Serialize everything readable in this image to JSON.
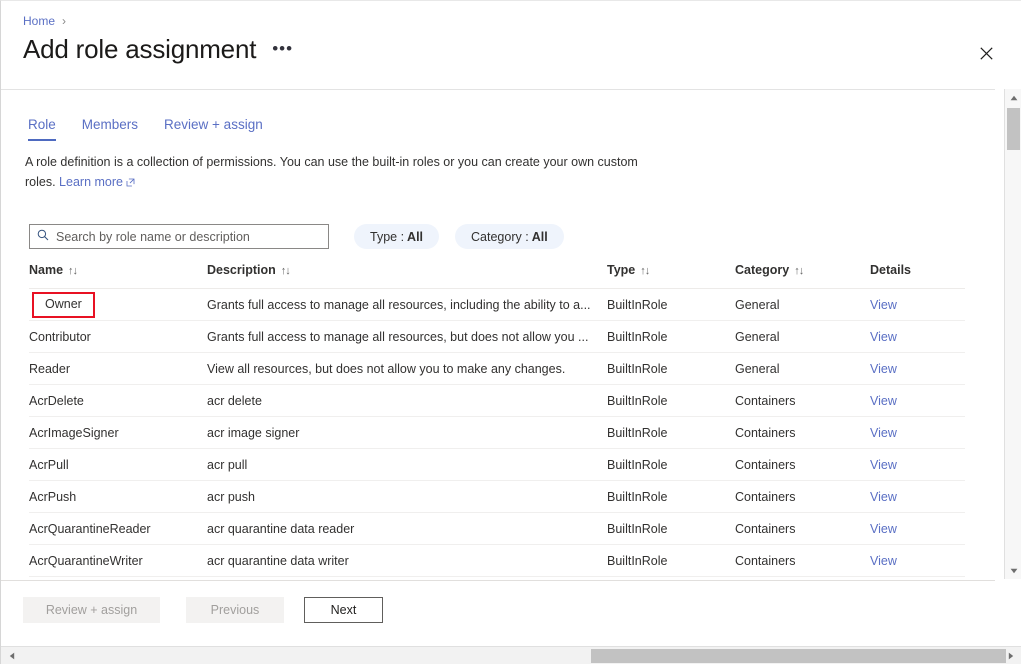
{
  "breadcrumb": {
    "home": "Home",
    "separator": "›"
  },
  "header": {
    "title": "Add role assignment",
    "more_label": "•••",
    "close_label": "✕"
  },
  "tabs": [
    {
      "label": "Role",
      "active": true
    },
    {
      "label": "Members",
      "active": false
    },
    {
      "label": "Review + assign",
      "active": false
    }
  ],
  "description": {
    "text": "A role definition is a collection of permissions. You can use the built-in roles or you can create your own custom roles. ",
    "link": "Learn more"
  },
  "search": {
    "placeholder": "Search by role name or description",
    "value": "",
    "icon": "search-icon"
  },
  "filters": [
    {
      "label": "Type :",
      "value": "All"
    },
    {
      "label": "Category :",
      "value": "All"
    }
  ],
  "table": {
    "sort_glyph": "↑↓",
    "columns": [
      {
        "key": "name",
        "label": "Name",
        "sortable": true
      },
      {
        "key": "description",
        "label": "Description",
        "sortable": true
      },
      {
        "key": "type",
        "label": "Type",
        "sortable": true
      },
      {
        "key": "category",
        "label": "Category",
        "sortable": true
      },
      {
        "key": "details",
        "label": "Details",
        "sortable": false
      }
    ],
    "details_link_label": "View",
    "rows": [
      {
        "name": "Owner",
        "description": "Grants full access to manage all resources, including the ability to a...",
        "type": "BuiltInRole",
        "category": "General",
        "details": "View",
        "highlighted": true
      },
      {
        "name": "Contributor",
        "description": "Grants full access to manage all resources, but does not allow you ...",
        "type": "BuiltInRole",
        "category": "General",
        "details": "View",
        "highlighted": false
      },
      {
        "name": "Reader",
        "description": "View all resources, but does not allow you to make any changes.",
        "type": "BuiltInRole",
        "category": "General",
        "details": "View",
        "highlighted": false
      },
      {
        "name": "AcrDelete",
        "description": "acr delete",
        "type": "BuiltInRole",
        "category": "Containers",
        "details": "View",
        "highlighted": false
      },
      {
        "name": "AcrImageSigner",
        "description": "acr image signer",
        "type": "BuiltInRole",
        "category": "Containers",
        "details": "View",
        "highlighted": false
      },
      {
        "name": "AcrPull",
        "description": "acr pull",
        "type": "BuiltInRole",
        "category": "Containers",
        "details": "View",
        "highlighted": false
      },
      {
        "name": "AcrPush",
        "description": "acr push",
        "type": "BuiltInRole",
        "category": "Containers",
        "details": "View",
        "highlighted": false
      },
      {
        "name": "AcrQuarantineReader",
        "description": "acr quarantine data reader",
        "type": "BuiltInRole",
        "category": "Containers",
        "details": "View",
        "highlighted": false
      },
      {
        "name": "AcrQuarantineWriter",
        "description": "acr quarantine data writer",
        "type": "BuiltInRole",
        "category": "Containers",
        "details": "View",
        "highlighted": false
      }
    ]
  },
  "footer": {
    "review_label": "Review + assign",
    "previous_label": "Previous",
    "next_label": "Next"
  },
  "colors": {
    "link": "#5a6fc4",
    "tab_active_underline": "#4e6ac0",
    "pill_background": "#eff4fc",
    "highlight_border": "#e81123",
    "text": "#323130"
  }
}
